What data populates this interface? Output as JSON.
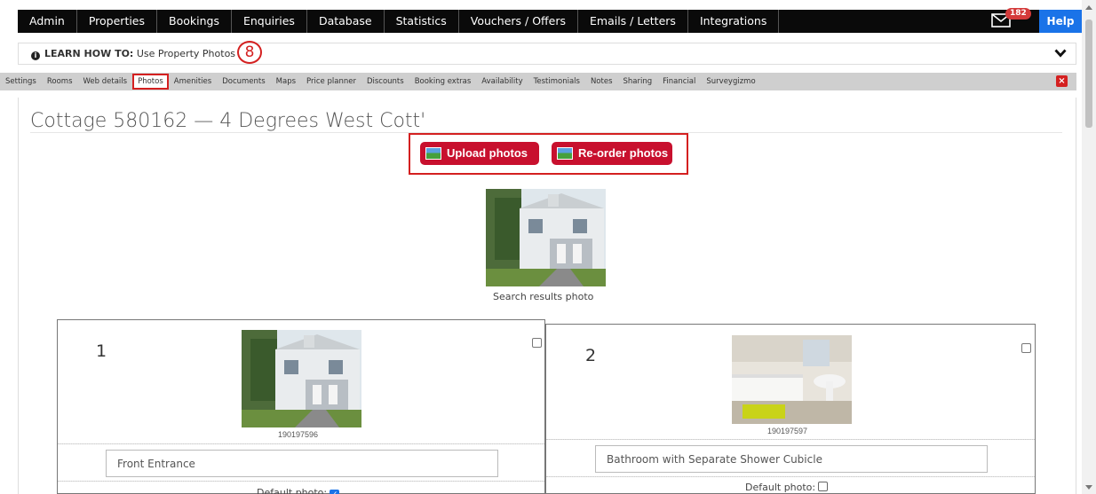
{
  "topnav": {
    "items": [
      "Admin",
      "Properties",
      "Bookings",
      "Enquiries",
      "Database",
      "Statistics",
      "Vouchers / Offers",
      "Emails / Letters",
      "Integrations"
    ],
    "mail_count": "182",
    "help_label": "Help"
  },
  "learn": {
    "prefix": "LEARN HOW TO:",
    "text": "Use Property Photos",
    "step": "8"
  },
  "subtabs": [
    "Settings",
    "Rooms",
    "Web details",
    "Photos",
    "Amenities",
    "Documents",
    "Maps",
    "Price planner",
    "Discounts",
    "Booking extras",
    "Availability",
    "Testimonials",
    "Notes",
    "Sharing",
    "Financial",
    "Surveygizmo"
  ],
  "active_subtab": "Photos",
  "page": {
    "title": "Cottage 580162 — 4 Degrees West Cott'",
    "upload_label": "Upload photos",
    "reorder_label": "Re-order photos",
    "search_caption": "Search results photo"
  },
  "photos": [
    {
      "num": "1",
      "id": "190197596",
      "caption": "Front Entrance",
      "default_label": "Default photo:",
      "default_checked": true
    },
    {
      "num": "2",
      "id": "190197597",
      "caption": "Bathroom with Separate Shower Cubicle",
      "default_label": "Default photo:",
      "default_checked": false
    }
  ],
  "colors": {
    "accent_red": "#c8102e",
    "nav_black": "#0a0a0a",
    "help_blue": "#1a73e8"
  }
}
